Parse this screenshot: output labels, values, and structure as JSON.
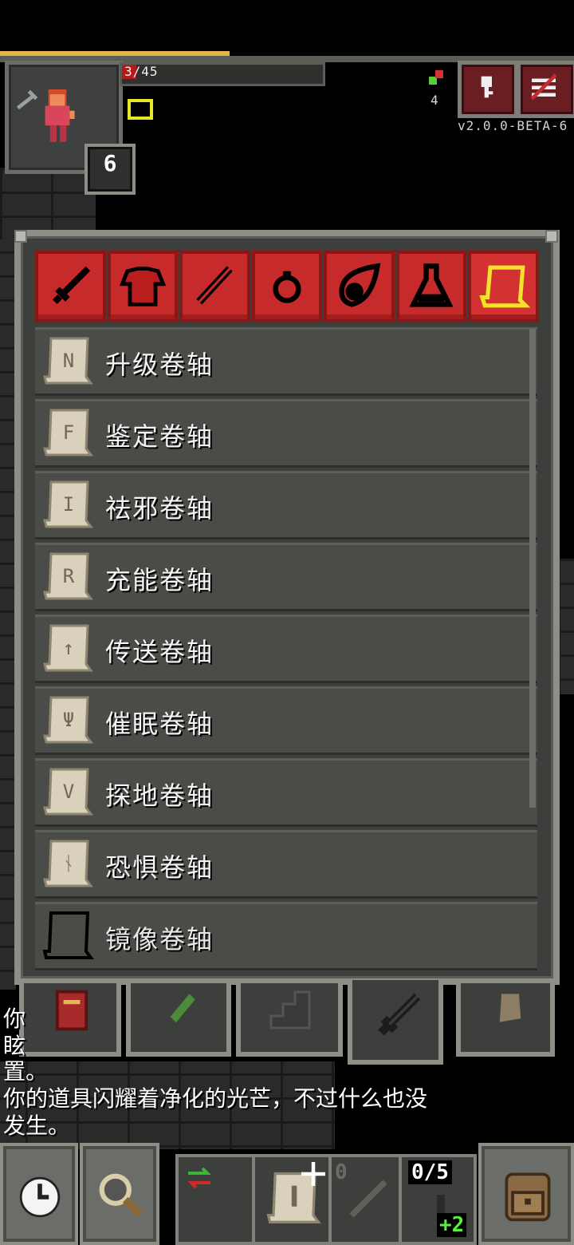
{
  "status": {
    "hp_text": "3/45",
    "level": "6",
    "gem_count": "4",
    "version": "v2.0.0-BETA-6",
    "xp_fraction": 0.4
  },
  "inventory": {
    "category_tabs": [
      "weapon-icon",
      "armor-icon",
      "wand-icon",
      "ring-icon",
      "artifact-icon",
      "potion-icon",
      "scroll-icon"
    ],
    "active_tab": "scroll-icon",
    "items": [
      {
        "label": "升级卷轴",
        "rune": "N",
        "known": true
      },
      {
        "label": "鉴定卷轴",
        "rune": "F",
        "known": true
      },
      {
        "label": "祛邪卷轴",
        "rune": "I",
        "known": true
      },
      {
        "label": "充能卷轴",
        "rune": "R",
        "known": true
      },
      {
        "label": "传送卷轴",
        "rune": "↑",
        "known": true
      },
      {
        "label": "催眠卷轴",
        "rune": "Ψ",
        "known": true
      },
      {
        "label": "探地卷轴",
        "rune": "V",
        "known": true
      },
      {
        "label": "恐惧卷轴",
        "rune": "ᚾ",
        "known": true
      },
      {
        "label": "镜像卷轴",
        "rune": "",
        "known": false
      }
    ]
  },
  "log": {
    "line_partial_1": "你",
    "line_partial_2": "眩",
    "line_3": "置。",
    "line_4": "你的道具闪耀着净化的光芒，不过什么也没",
    "line_5": "发生。"
  },
  "toolbar": {
    "quickslot_count": "0",
    "dart_count": "0/5",
    "bonus": "+2"
  },
  "colors": {
    "tab_red": "#c72a2a",
    "highlight_yellow": "#f1e22b",
    "panel": "#3d3f3c"
  }
}
